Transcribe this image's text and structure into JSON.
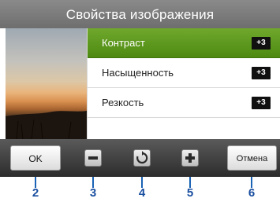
{
  "header": {
    "title": "Свойства изображения"
  },
  "preview": {
    "description_icon": "sunset-photo"
  },
  "settings": {
    "items": [
      {
        "label": "Контраст",
        "value": "+3",
        "selected": true
      },
      {
        "label": "Насыщенность",
        "value": "+3",
        "selected": false
      },
      {
        "label": "Резкость",
        "value": "+3",
        "selected": false
      }
    ]
  },
  "toolbar": {
    "ok_label": "OK",
    "cancel_label": "Отмена",
    "decrease_icon": "minus-icon",
    "reset_icon": "reset-icon",
    "increase_icon": "plus-icon"
  },
  "callouts": [
    "2",
    "3",
    "4",
    "5",
    "6"
  ],
  "colors": {
    "accent_green": "#5a9a1e",
    "callout_blue": "#1a4fa0",
    "title_bar": "#7a7a7a"
  }
}
